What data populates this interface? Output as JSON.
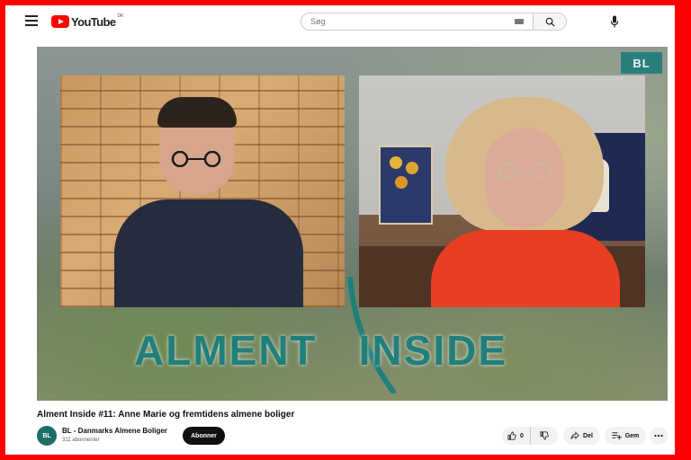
{
  "header": {
    "logo_text": "YouTube",
    "logo_country": "DK",
    "search_placeholder": "Søg"
  },
  "video": {
    "badge": "BL",
    "overlay_title_left": "ALMENT",
    "overlay_title_right": "INSIDE"
  },
  "details": {
    "title": "Alment Inside #11: Anne Marie og fremtidens almene boliger",
    "channel_avatar_text": "BL",
    "channel_name": "BL - Danmarks Almene Boliger",
    "subscribers": "311 abonnenter",
    "subscribe_label": "Abonner",
    "like_count": "0",
    "share_label": "Del",
    "save_label": "Gem"
  },
  "icons": {
    "menu": "menu-icon",
    "search": "search-icon",
    "keyboard": "keyboard-icon",
    "mic": "mic-icon",
    "like": "thumbs-up-icon",
    "dislike": "thumbs-down-icon",
    "share": "share-icon",
    "save": "playlist-add-icon",
    "more": "more-icon"
  },
  "colors": {
    "border": "#ff0000",
    "brand": "#ff0000",
    "teal": "#217f7b",
    "subscribe_bg": "#0f0f0f"
  }
}
